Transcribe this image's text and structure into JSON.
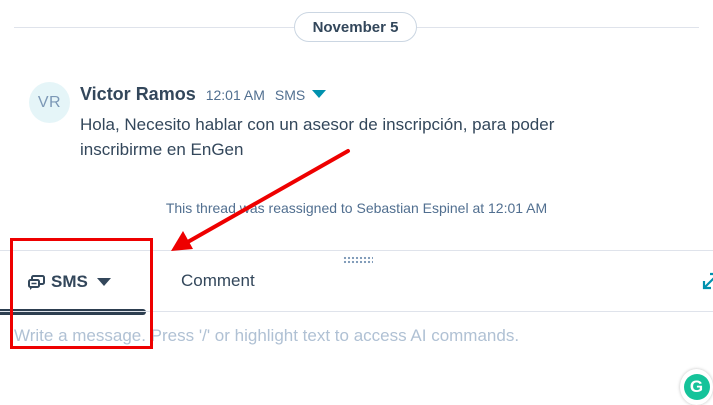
{
  "thread": {
    "date_label": "November 5",
    "message": {
      "avatar_initials": "VR",
      "sender": "Victor Ramos",
      "time": "12:01 AM",
      "channel": "SMS",
      "body": "Hola, Necesito hablar con un asesor de inscripción, para poder inscribirme en EnGen"
    },
    "system_note": "This thread was reassigned to Sebastian Espinel at 12:01 AM"
  },
  "composer": {
    "tabs": [
      {
        "label": "SMS",
        "icon": "sms-icon",
        "active": true
      },
      {
        "label": "Comment",
        "active": false
      }
    ],
    "placeholder": "Write a message. Press '/' or highlight text to access AI commands."
  },
  "extension": {
    "label": "G",
    "icon": "grammarly-icon"
  },
  "colors": {
    "text": "#33475b",
    "muted": "#516f90",
    "accent": "#0091ae",
    "annotation": "#ee0000",
    "grammarly": "#15c39a"
  }
}
